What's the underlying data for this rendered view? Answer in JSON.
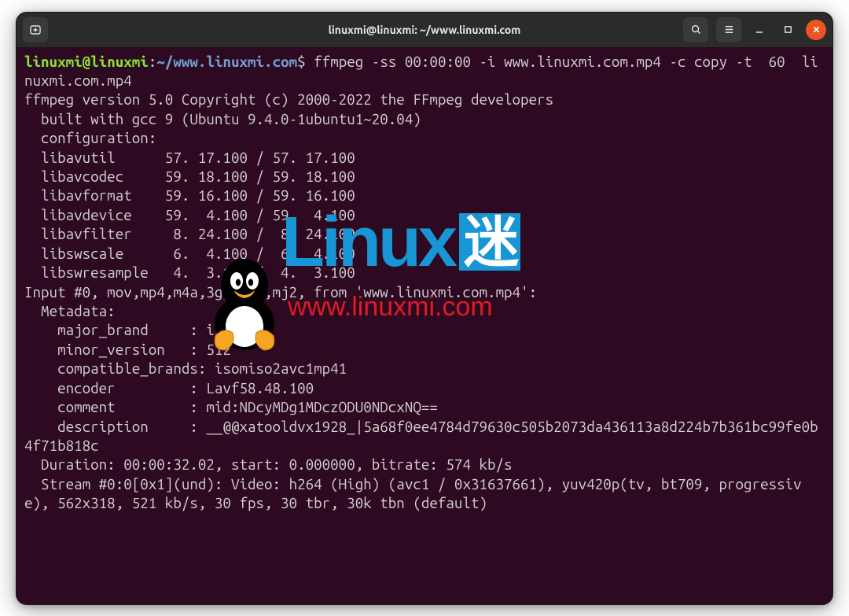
{
  "titlebar": {
    "title": "linuxmi@linuxmi: ~/www.linuxmi.com"
  },
  "prompt": {
    "user": "linuxmi",
    "at": "@",
    "host": "linuxmi",
    "colon": ":",
    "tilde": "~",
    "path": "/www.linuxmi.com",
    "dollar": "$"
  },
  "command": "ffmpeg -ss 00:00:00 -i www.linuxmi.com.mp4 -c copy -t  60  linuxmi.com.mp4",
  "output": [
    "ffmpeg version 5.0 Copyright (c) 2000-2022 the FFmpeg developers",
    "  built with gcc 9 (Ubuntu 9.4.0-1ubuntu1~20.04)",
    "  configuration:",
    "  libavutil      57. 17.100 / 57. 17.100",
    "  libavcodec     59. 18.100 / 59. 18.100",
    "  libavformat    59. 16.100 / 59. 16.100",
    "  libavdevice    59.  4.100 / 59.  4.100",
    "  libavfilter     8. 24.100 /  8. 24.100",
    "  libswscale      6.  4.100 /  6.  4.100",
    "  libswresample   4.  3.100 /  4.  3.100",
    "Input #0, mov,mp4,m4a,3gp,3g2,mj2, from 'www.linuxmi.com.mp4':",
    "  Metadata:",
    "    major_brand     : isom",
    "    minor_version   : 512",
    "    compatible_brands: isomiso2avc1mp41",
    "    encoder         : Lavf58.48.100",
    "    comment         : mid:NDcyMDg1MDczODU0NDcxNQ==",
    "    description     : __@@xatooldvx1928_|5a68f0ee4784d79630c505b2073da436113a8d224b7b361bc99fe0b4f71b818c",
    "  Duration: 00:00:32.02, start: 0.000000, bitrate: 574 kb/s",
    "  Stream #0:0[0x1](und): Video: h264 (High) (avc1 / 0x31637661), yuv420p(tv, bt709, progressive), 562x318, 521 kb/s, 30 fps, 30 tbr, 30k tbn (default)"
  ],
  "watermark": {
    "word": "Linux",
    "mi": "迷",
    "url": "www.linuxmi.com"
  }
}
